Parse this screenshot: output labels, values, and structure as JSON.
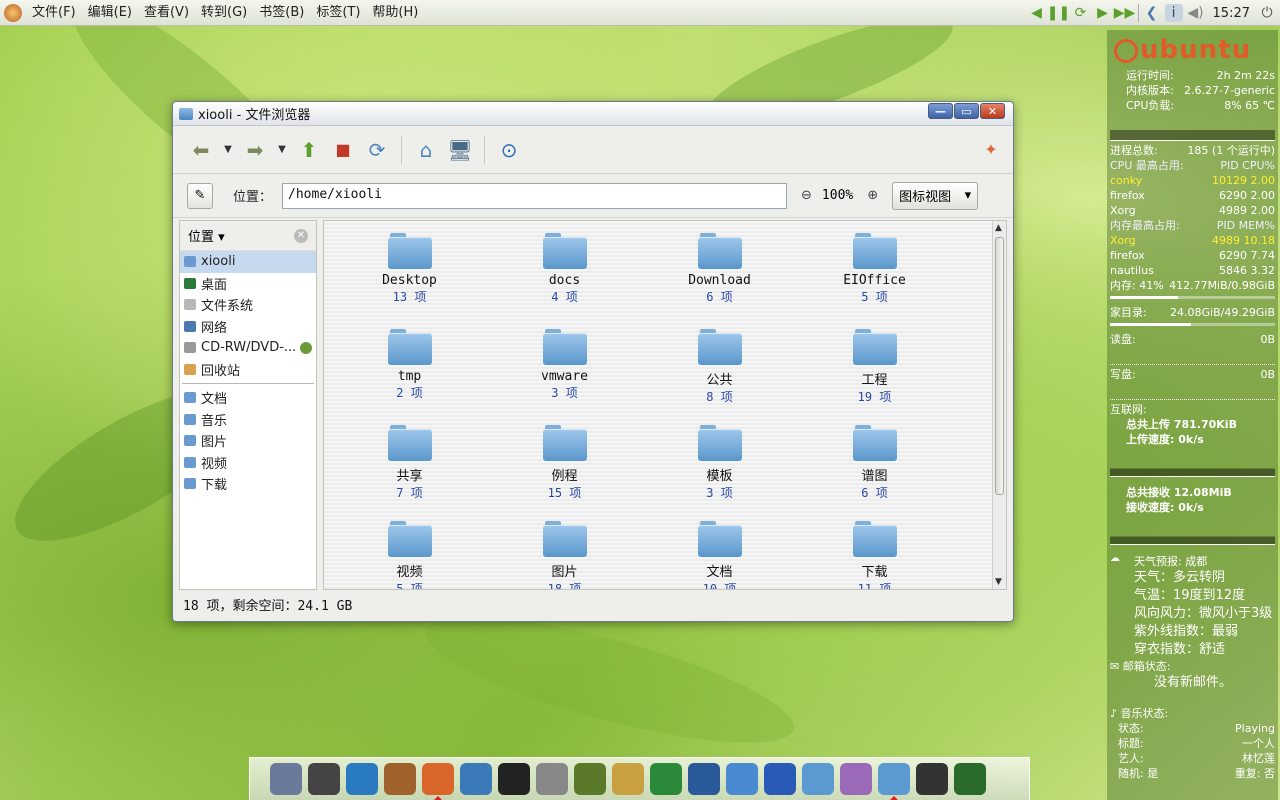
{
  "top_panel": {
    "menu": [
      "文件(F)",
      "编辑(E)",
      "查看(V)",
      "转到(G)",
      "书签(B)",
      "标签(T)",
      "帮助(H)"
    ],
    "clock": "15:27"
  },
  "window": {
    "title": "xiooli - 文件浏览器",
    "location_label": "位置：",
    "location_value": "/home/xiooli",
    "zoom": "100%",
    "view_mode": "图标视图",
    "sidebar_title": "位置",
    "sidebar_places": [
      {
        "label": "xiooli",
        "icon": "home-icon",
        "selected": true
      },
      {
        "label": "桌面",
        "icon": "desktop-icon"
      },
      {
        "label": "文件系统",
        "icon": "harddisk-icon"
      },
      {
        "label": "网络",
        "icon": "network-icon"
      },
      {
        "label": "CD-RW/DVD-...",
        "icon": "cdrom-icon"
      },
      {
        "label": "回收站",
        "icon": "trash-icon"
      }
    ],
    "sidebar_bookmarks": [
      {
        "label": "文档"
      },
      {
        "label": "音乐"
      },
      {
        "label": "图片"
      },
      {
        "label": "视频"
      },
      {
        "label": "下载"
      }
    ],
    "files": [
      {
        "name": "Desktop",
        "count": "13 项"
      },
      {
        "name": "docs",
        "count": "4 项"
      },
      {
        "name": "Download",
        "count": "6 项"
      },
      {
        "name": "EIOffice",
        "count": "5 项"
      },
      {
        "name": "tmp",
        "count": "2 项"
      },
      {
        "name": "vmware",
        "count": "3 项"
      },
      {
        "name": "公共",
        "count": "8 项"
      },
      {
        "name": "工程",
        "count": "19 项"
      },
      {
        "name": "共享",
        "count": "7 项"
      },
      {
        "name": "例程",
        "count": "15 项"
      },
      {
        "name": "模板",
        "count": "3 项"
      },
      {
        "name": "谱图",
        "count": "6 项"
      },
      {
        "name": "视频",
        "count": "5 项"
      },
      {
        "name": "图片",
        "count": "18 项"
      },
      {
        "name": "文档",
        "count": "10 项"
      },
      {
        "name": "下载",
        "count": "11 项"
      }
    ],
    "status": "18 项，剩余空间：24.1 GB"
  },
  "conky": {
    "logo": "ubuntu",
    "uptime_label": "运行时间:",
    "uptime": "2h 2m 22s",
    "kernel_label": "内核版本:",
    "kernel": "2.6.27-7-generic",
    "cpu_label": "CPU负载:",
    "cpu": "8%  65 ℃",
    "proc_label": "进程总数:",
    "proc": "185 (1 个运行中)",
    "cpu_top_header": "CPU 最高占用:",
    "cpu_top_cols": "PID  CPU%",
    "cpu_top": [
      {
        "name": "conky",
        "pid": "10129",
        "val": "2.00",
        "hl": true
      },
      {
        "name": "firefox",
        "pid": "6290",
        "val": "2.00"
      },
      {
        "name": "Xorg",
        "pid": "4989",
        "val": "2.00"
      }
    ],
    "mem_top_header": "内存最高占用:",
    "mem_top_cols": "PID  MEM%",
    "mem_top": [
      {
        "name": "Xorg",
        "pid": "4989",
        "val": "10.18",
        "hl": true
      },
      {
        "name": "firefox",
        "pid": "6290",
        "val": "7.74"
      },
      {
        "name": "nautilus",
        "pid": "5846",
        "val": "3.32"
      }
    ],
    "mem_label": "内存: 41%",
    "mem_value": "412.77MiB/0.98GiB",
    "mem_fraction": 0.41,
    "home_label": "家目录:",
    "home_value": "24.08GiB/49.29GiB",
    "home_fraction": 0.49,
    "read_label": "读盘:",
    "read_value": "0B",
    "write_label": "写盘:",
    "write_value": "0B",
    "net_label": "互联网:",
    "up_total": "总共上传 781.70KiB",
    "up_speed": "上传速度: 0k/s",
    "down_total": "总共接收 12.08MiB",
    "down_speed": "接收速度: 0k/s",
    "weather_label": "天气预报: 成都",
    "weather": "天气：多云转阴",
    "temp": "气温：19度到12度",
    "wind": "风向风力：微风小于3级",
    "uv": "紫外线指数：最弱",
    "dress": "穿衣指数：舒适",
    "mail_label": "邮箱状态:",
    "mail": "没有新邮件。",
    "music_label": "音乐状态:",
    "music_state_label": "状态:",
    "music_state": "Playing",
    "music_title_label": "标题:",
    "music_title": "一个人",
    "music_artist_label": "艺人:",
    "music_artist": "林忆莲",
    "music_shuffle": "随机: 是",
    "music_repeat": "重复: 否"
  },
  "dock": {
    "items": [
      "tools-icon",
      "headphones-icon",
      "qq-icon",
      "ubuntu-tweak-icon",
      "firefox-icon",
      "screenshot-icon",
      "terminal-icon",
      "calculator-icon",
      "dictionary-icon",
      "font-icon",
      "rss-icon",
      "chart-icon",
      "display-icon",
      "globe-icon",
      "monitor-icon",
      "package-icon",
      "folder-icon",
      "terminal-window-icon",
      "system-monitor-icon"
    ]
  }
}
